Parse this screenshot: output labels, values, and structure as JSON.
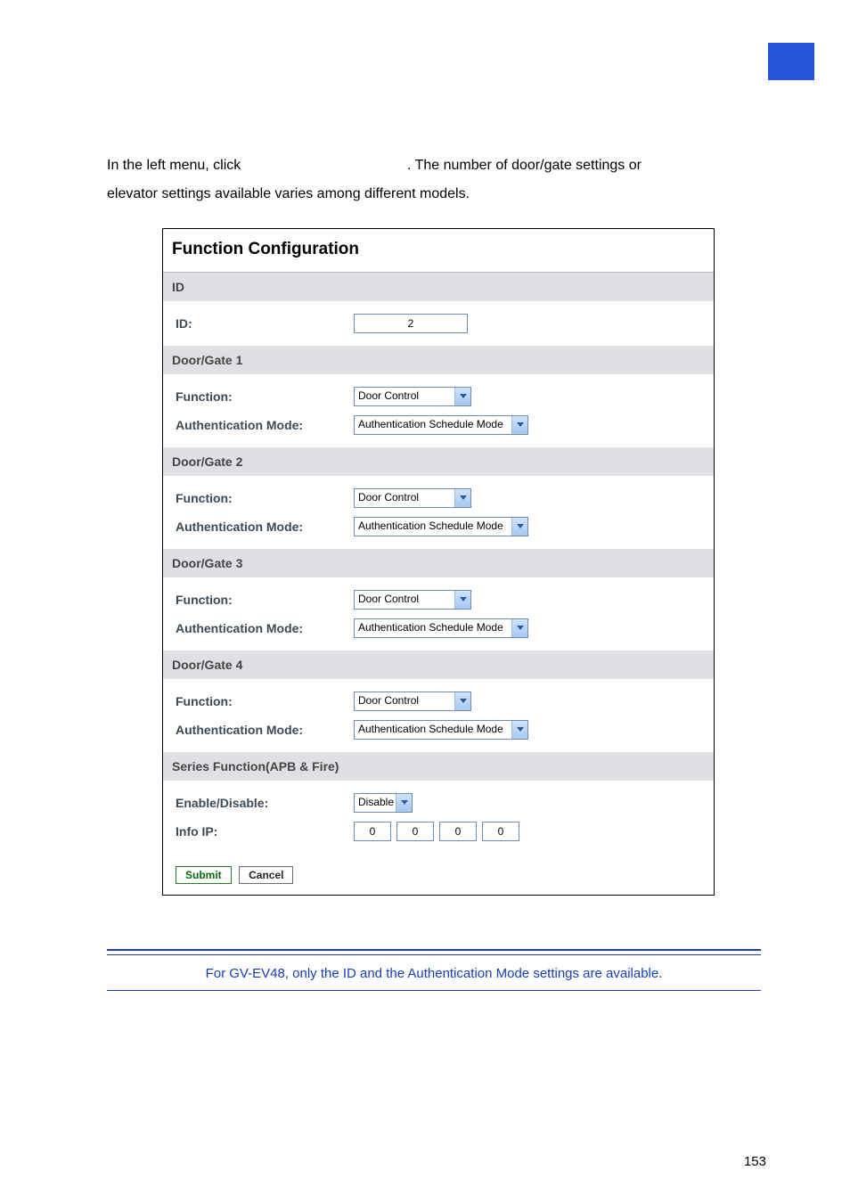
{
  "intro": {
    "line1_prefix": "In the left menu, click ",
    "line1_gap": "                                         ",
    "line1_suffix": ". The number of door/gate settings or",
    "line2": "elevator settings available varies among different models."
  },
  "panel": {
    "title": "Function Configuration",
    "sections": {
      "id": {
        "header": "ID",
        "label": "ID:",
        "value": "2"
      },
      "gates": [
        {
          "header": "Door/Gate 1",
          "function_label": "Function:",
          "function_value": "Door Control",
          "auth_label": "Authentication Mode:",
          "auth_value": "Authentication Schedule Mode"
        },
        {
          "header": "Door/Gate 2",
          "function_label": "Function:",
          "function_value": "Door Control",
          "auth_label": "Authentication Mode:",
          "auth_value": "Authentication Schedule Mode"
        },
        {
          "header": "Door/Gate 3",
          "function_label": "Function:",
          "function_value": "Door Control",
          "auth_label": "Authentication Mode:",
          "auth_value": "Authentication Schedule Mode"
        },
        {
          "header": "Door/Gate 4",
          "function_label": "Function:",
          "function_value": "Door Control",
          "auth_label": "Authentication Mode:",
          "auth_value": "Authentication Schedule Mode"
        }
      ],
      "series": {
        "header": "Series Function(APB & Fire)",
        "enable_label": "Enable/Disable:",
        "enable_value": "Disable",
        "infoip_label": "Info IP:",
        "ip": [
          "0",
          "0",
          "0",
          "0"
        ]
      }
    },
    "buttons": {
      "submit": "Submit",
      "cancel": "Cancel"
    }
  },
  "footnote": "For GV-EV48, only the ID and the Authentication Mode settings are available.",
  "page_number": "153"
}
